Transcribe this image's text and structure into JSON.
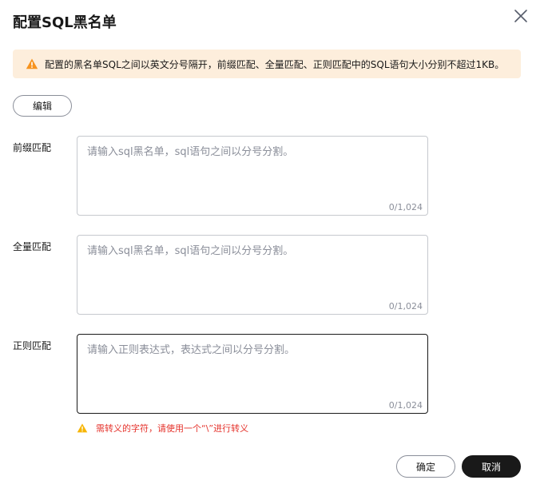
{
  "dialog": {
    "title": "配置SQL黑名单",
    "close_icon": "close-icon"
  },
  "alert": {
    "icon": "warning-icon",
    "color": "#f7931e",
    "text": "配置的黑名单SQL之间以英文分号隔开，前缀匹配、全量匹配、正则匹配中的SQL语句大小分别不超过1KB。"
  },
  "toolbar": {
    "edit_label": "编辑"
  },
  "fields": [
    {
      "label": "前缀匹配",
      "value": "",
      "placeholder": "请输入sql黑名单，sql语句之间以分号分割。",
      "counter": "0/1,024"
    },
    {
      "label": "全量匹配",
      "value": "",
      "placeholder": "请输入sql黑名单，sql语句之间以分号分割。",
      "counter": "0/1,024"
    },
    {
      "label": "正则匹配",
      "value": "",
      "placeholder": "请输入正则表达式，表达式之间以分号分割。",
      "counter": "0/1,024"
    }
  ],
  "regex_hint": {
    "icon": "warning-icon",
    "color": "#e5332c",
    "text": "需转义的字符，请使用一个“\\”进行转义"
  },
  "footer": {
    "confirm_label": "确定",
    "cancel_label": "取消"
  }
}
